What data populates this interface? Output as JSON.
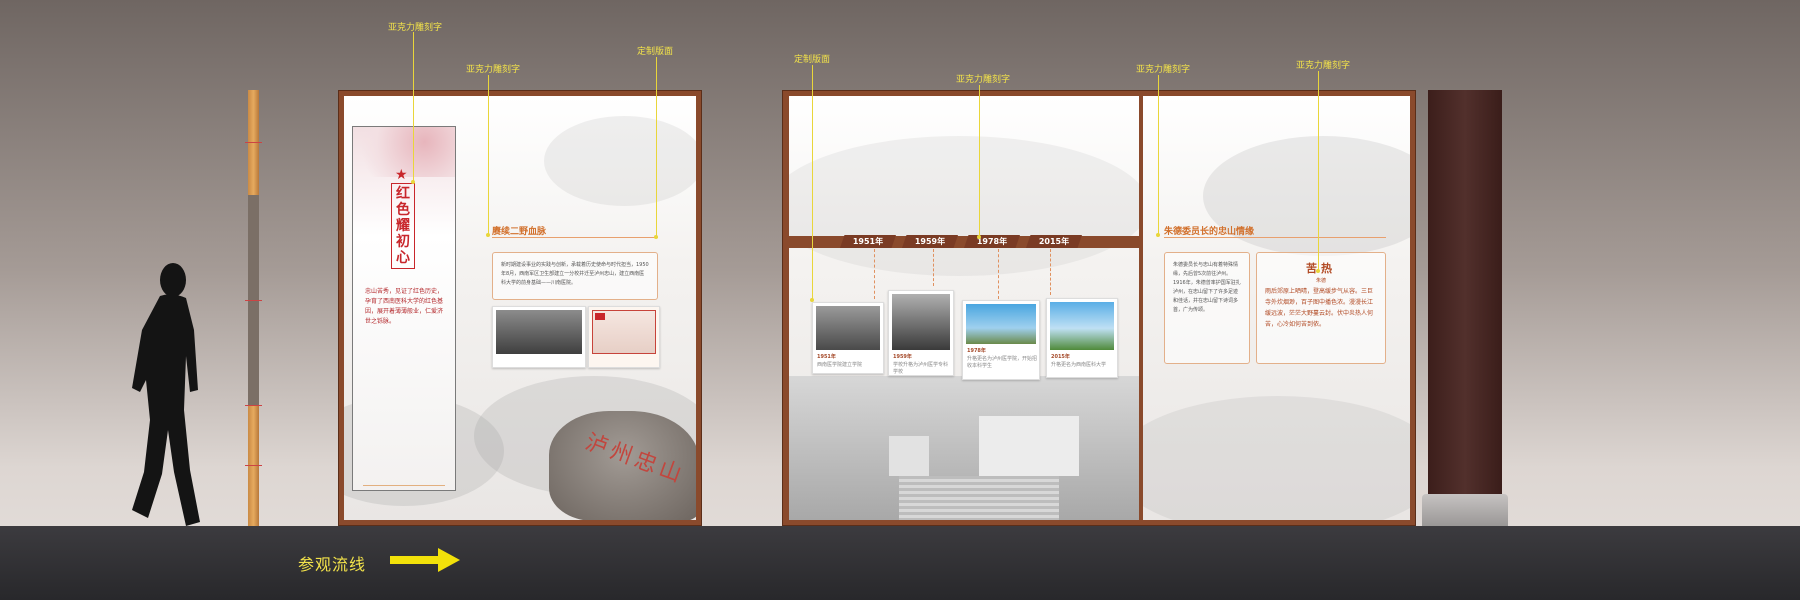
{
  "callouts": {
    "acrylic_1": "亚克力雕刻字",
    "acrylic_2": "亚克力雕刻字",
    "custom_1": "定制版面",
    "custom_2": "定制版面",
    "acrylic_3": "亚克力雕刻字",
    "acrylic_4": "亚克力雕刻字",
    "acrylic_5": "亚克力雕刻字"
  },
  "left_panel": {
    "banner_title": "红色耀初心",
    "banner_text": "忠山苦秀，见证了红色历史，孕育了西南医科大学的红色基因，展开着薄薄般业，仁爱济世之铄脉。",
    "section_title": "赓续二野血脉",
    "section_text": "新时期建设事业的实践与创新，承载着历史使命与时代担当，1950年8月，西南军区卫生部建立一分校并迁至泸州忠山，建立西南医科大学的前身基础——川南医院。",
    "rock_text": "泸州忠山"
  },
  "timeline": {
    "years": [
      "1951年",
      "1959年",
      "1978年",
      "2015年"
    ],
    "cards": [
      {
        "year": "1951年",
        "text": "西南医学院建立学院"
      },
      {
        "year": "1959年",
        "text": "学校升格为泸州医学专科学校"
      },
      {
        "year": "1978年",
        "text": "升格更名为泸州医学院，开始招收本科学生"
      },
      {
        "year": "2015年",
        "text": "升格更名为西南医科大学"
      }
    ]
  },
  "right_panel": {
    "section_title": "朱德委员长的忠山情缘",
    "text_left": "朱德委员长与忠山有着特殊情缘，先后曾5次前往泸州。1916年，朱德曾率护国军驻扎泸州，在忠山留下了许多足迹和佳话，并在忠山留下诗词多首，广为传颂。",
    "poem_title": "苦热",
    "poem_author": "朱德",
    "poem_text": "雨后郊原上晒晴，登高缓步气从容。三巨寺外炊烟渺，百子图中播色浓。漫漫长江缓远波，茫茫大野蔓云封。伏中炎热人何苦，心冷如何苦到侬。"
  },
  "flow": {
    "label": "参观流线"
  }
}
